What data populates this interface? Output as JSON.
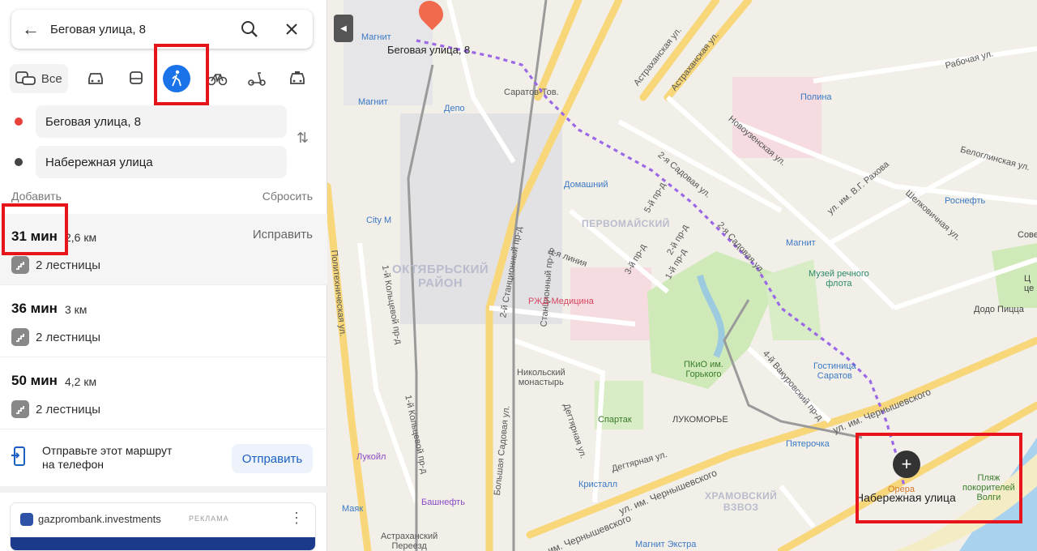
{
  "search": {
    "query": "Беговая улица, 8"
  },
  "modes": {
    "all_label": "Все"
  },
  "route_points": {
    "from": "Беговая улица, 8",
    "to": "Набережная улица"
  },
  "links": {
    "add": "Добавить",
    "reset": "Сбросить"
  },
  "routes": [
    {
      "time": "31 мин",
      "distance": "2,6 км",
      "stairs": "2 лестницы",
      "fix": "Исправить"
    },
    {
      "time": "36 мин",
      "distance": "3 км",
      "stairs": "2 лестницы"
    },
    {
      "time": "50 мин",
      "distance": "4,2 км",
      "stairs": "2 лестницы"
    }
  ],
  "send": {
    "text_line1": "Отправьте этот маршрут",
    "text_line2": "на телефон",
    "button": "Отправить"
  },
  "ad": {
    "title": "gazprombank.investments",
    "tag": "РЕКЛАМА"
  },
  "map": {
    "start_label": "Беговая улица, 8",
    "end_label": "Набережная улица",
    "districts": {
      "oktyabrsky_1": "ОКТЯБРЬСКИЙ",
      "oktyabrsky_2": "РАЙОН",
      "pervomaysky": "ПЕРВОМАЙСКИЙ",
      "khramovsky_1": "ХРАМОВСКИЙ",
      "khramovsky_2": "ВЗВОЗ"
    },
    "streets": {
      "astrakhanskaya1": "Астраханская ул.",
      "astrakhanskaya2": "Астраханская ул.",
      "rabochaya": "Рабочая ул.",
      "novouzenskaya": "Новоузенская ул.",
      "belogllinskaya": "Белоглинская ул.",
      "rakhova": "ул. им. В.Г. Рахова",
      "shelkovichnaya": "Шелковичная ул.",
      "sadovaya2a": "2-я Садовая ул.",
      "sadovaya2b": "2-я Садовая ул.",
      "proezd5": "5-й пр-д",
      "proezd3": "3-й пр-д",
      "proezd2": "2-й пр-д",
      "proezd1": "1-й пр-д",
      "liniya9": "9-я линия",
      "stantsionny2": "2-й Станционный пр-д",
      "stantsionny": "Станционный пр-д",
      "politekh": "Политехническая ул.",
      "koltsevoy1": "1-й Кольцевой пр-д",
      "koltsevoy1b": "1-й Кольцевой пр-д",
      "bolshaya_sadovaya": "Большая Садовая ул.",
      "degtyarnaya": "Дегтярная ул.",
      "degtyarnaya2": "Дегтярная ул.",
      "vakurovsky": "4-й Вакуровский пр-д",
      "chernyshevskogo1": "ул. им. Чернышевского",
      "chernyshevskogo2": "ул. им. Чернышевского",
      "chernyshevskogo3": "ул. им. Чернышевского"
    },
    "pois": {
      "magnit_top": "Магнит",
      "magnit2": "Магнит",
      "magnit3": "Магнит",
      "depo": "Депо",
      "saratov_tov": "Саратов-Тов.",
      "polina": "Полина",
      "domashny": "Домашний",
      "rosneft": "Роснефть",
      "city_m": "City M",
      "rzd": "РЖД-Медицина",
      "muzey1": "Музей речного",
      "muzey2": "флота",
      "dodo": "Додо Пицца",
      "nikolsky1": "Никольский",
      "nikolsky2": "монастырь",
      "pkio1": "ПКиО им.",
      "pkio2": "Горького",
      "gostinitsa1": "Гостиница",
      "gostinitsa2": "Саратов",
      "spartak": "Спартак",
      "lukomorye": "ЛУКОМОРЬЕ",
      "pyaterochka": "Пятерочка",
      "lukoil": "Лукойл",
      "kristall": "Кристалл",
      "bashneft": "Башнефть",
      "mayak": "Маяк",
      "astr_pereezd1": "Астраханский",
      "astr_pereezd2": "Переезд",
      "magnit_extra": "Магнит Экстра",
      "plyazh1": "Пляж",
      "plyazh2": "покорителей",
      "plyazh3": "Волги",
      "opera": "Орера",
      "sove": "Сове",
      "ts": "Ц",
      "tse": "це"
    }
  }
}
